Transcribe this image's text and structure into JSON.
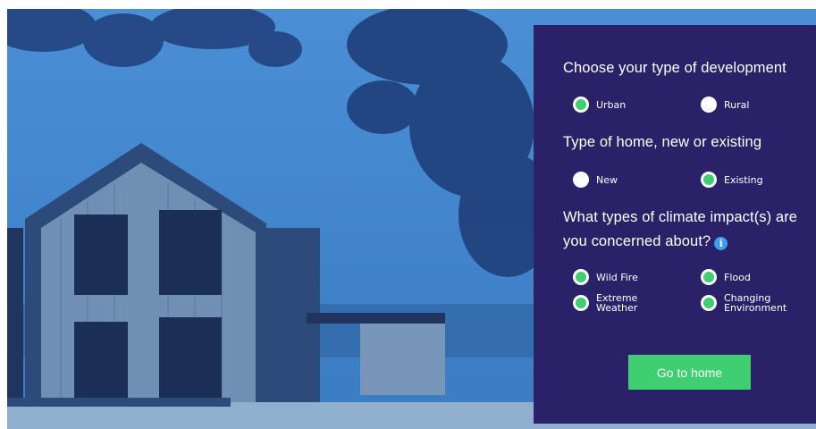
{
  "background": {
    "photo_icon": "house-photo",
    "tint": "#3a7cc4"
  },
  "panel": {
    "bg_color": "#2a2168",
    "accent": "#3fcf70",
    "q1": {
      "title": "Choose your type of development",
      "options": [
        {
          "label": "Urban",
          "checked": true
        },
        {
          "label": "Rural",
          "checked": false
        }
      ]
    },
    "q2": {
      "title": "Type of home, new or existing",
      "options": [
        {
          "label": "New",
          "checked": false
        },
        {
          "label": "Existing",
          "checked": true
        }
      ]
    },
    "q3": {
      "title_line1": "What types of climate impact(s) are",
      "title_line2": "you concerned about?",
      "info_icon": "i",
      "options": [
        {
          "label": "Wild Fire",
          "checked": true
        },
        {
          "label": "Flood",
          "checked": true
        },
        {
          "label_line1": "Extreme",
          "label_line2": "Weather",
          "checked": true
        },
        {
          "label_line1": "Changing",
          "label_line2": "Environment",
          "checked": true
        }
      ]
    },
    "go_button": "Go to home"
  }
}
